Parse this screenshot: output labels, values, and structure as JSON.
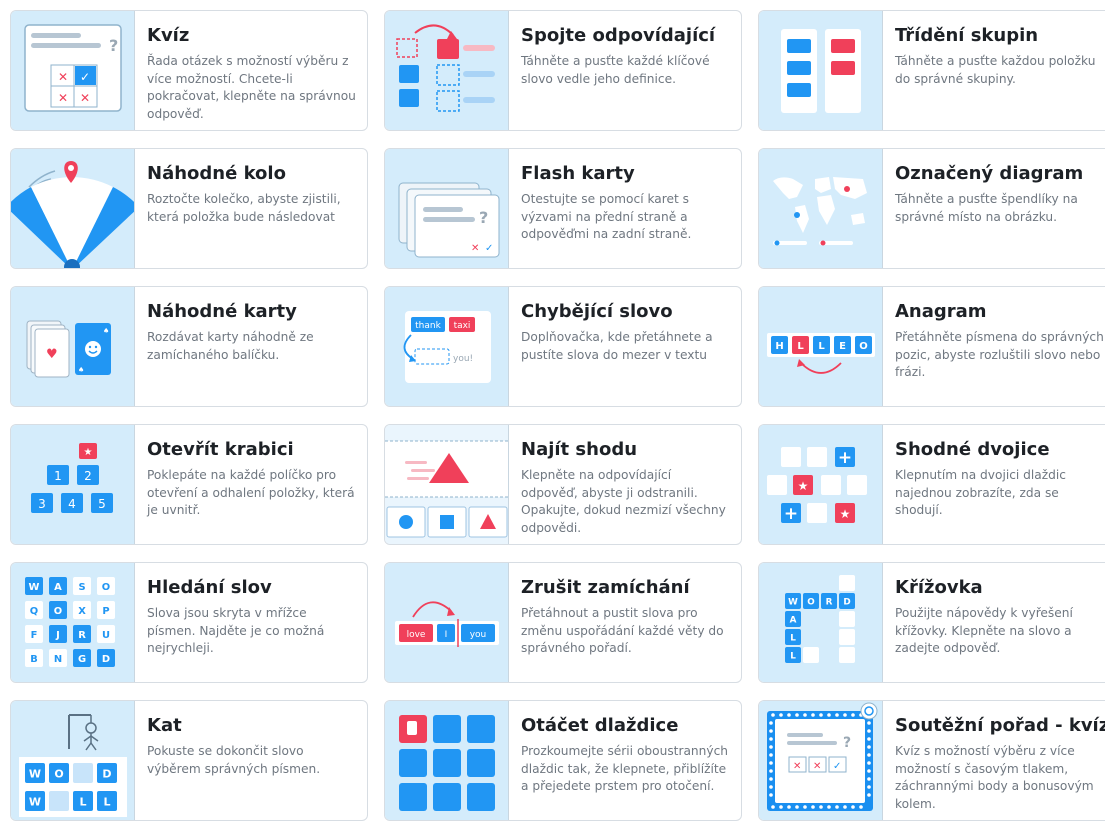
{
  "templates": [
    {
      "id": "quiz",
      "title": "Kvíz",
      "description": "Řada otázek s možností výběru z více možností. Chcete-li pokračovat, klepněte na správnou odpověď.",
      "icon": "quiz-icon"
    },
    {
      "id": "match",
      "title": "Spojte odpovídající",
      "description": "Táhněte a pusťte každé klíčové slovo vedle jeho definice.",
      "icon": "match-up-icon"
    },
    {
      "id": "group",
      "title": "Třídění skupin",
      "description": "Táhněte a pusťte každou položku do správné skupiny.",
      "icon": "group-sort-icon"
    },
    {
      "id": "wheel",
      "title": "Náhodné kolo",
      "description": "Roztočte kolečko, abyste zjistili, která položka bude následovat",
      "icon": "random-wheel-icon"
    },
    {
      "id": "flash",
      "title": "Flash karty",
      "description": "Otestujte se pomocí karet s výzvami na přední straně a odpověďmi na zadní straně.",
      "icon": "flash-cards-icon"
    },
    {
      "id": "diagram",
      "title": "Označený diagram",
      "description": "Táhněte a pusťte špendlíky na správné místo na obrázku.",
      "icon": "labelled-diagram-icon"
    },
    {
      "id": "cards",
      "title": "Náhodné karty",
      "description": "Rozdávat karty náhodně ze zamíchaného balíčku.",
      "icon": "random-cards-icon"
    },
    {
      "id": "missing",
      "title": "Chybějící slovo",
      "description": "Doplňovačka, kde přetáhnete a pustíte slova do mezer v textu",
      "icon": "missing-word-icon",
      "words": [
        "thank",
        "taxi",
        "you!"
      ]
    },
    {
      "id": "anagram",
      "title": "Anagram",
      "description": "Přetáhněte písmena do správných pozic, abyste rozluštili slovo nebo frázi.",
      "icon": "anagram-icon",
      "letters": [
        "H",
        "L",
        "L",
        "E",
        "O"
      ]
    },
    {
      "id": "box",
      "title": "Otevřít krabici",
      "description": "Poklepáte na každé políčko pro otevření a odhalení položky, která je uvnitř.",
      "icon": "open-box-icon",
      "numbers": [
        "1",
        "2",
        "3",
        "4",
        "5"
      ]
    },
    {
      "id": "find",
      "title": "Najít shodu",
      "description": "Klepněte na odpovídající odpověď, abyste ji odstranili. Opakujte, dokud nezmizí všechny odpovědi.",
      "icon": "find-match-icon"
    },
    {
      "id": "pairs",
      "title": "Shodné dvojice",
      "description": "Klepnutím na dvojici dlaždic najednou zobrazíte, zda se shodují.",
      "icon": "matching-pairs-icon"
    },
    {
      "id": "wordsearch",
      "title": "Hledání slov",
      "description": "Slova jsou skryta v mřížce písmen. Najděte je co možná nejrychleji.",
      "icon": "wordsearch-icon",
      "grid": [
        "WASO",
        "QOXP",
        "FJRU",
        "BNGD"
      ]
    },
    {
      "id": "unjumble",
      "title": "Zrušit zamíchání",
      "description": "Přetáhnout a pustit slova pro změnu uspořádání každé věty do správného pořadí.",
      "icon": "unjumble-icon",
      "words": [
        "love",
        "I",
        "you"
      ]
    },
    {
      "id": "crossword",
      "title": "Křížovka",
      "description": "Použijte nápovědy k vyřešení křížovky. Klepněte na slovo a zadejte odpověď.",
      "icon": "crossword-icon",
      "across": [
        "W",
        "O",
        "R",
        "D"
      ],
      "down": [
        "A",
        "L",
        "L"
      ]
    },
    {
      "id": "hangman",
      "title": "Kat",
      "description": "Pokuste se dokončit slovo výběrem správných písmen.",
      "icon": "hangman-icon",
      "row1": [
        "W",
        "O",
        "",
        "D"
      ],
      "row2": [
        "W",
        "",
        "L",
        "L"
      ]
    },
    {
      "id": "flip",
      "title": "Otáčet dlaždice",
      "description": "Prozkoumejte sérii oboustranných dlaždic tak, že klepnete, přiblížíte a přejedete prstem pro otočení.",
      "icon": "flip-tiles-icon"
    },
    {
      "id": "gameshow",
      "title": "Soutěžní pořad - kvíz",
      "description": "Kvíz s možností výběru z více možností s časovým tlakem, záchrannými body a bonusovým kolem.",
      "icon": "gameshow-quiz-icon"
    }
  ],
  "colors": {
    "blue": "#2196f3",
    "red": "#f0405a",
    "thumb_bg": "#d4ecfb",
    "text": "#1d2126",
    "muted": "#6f7780"
  }
}
